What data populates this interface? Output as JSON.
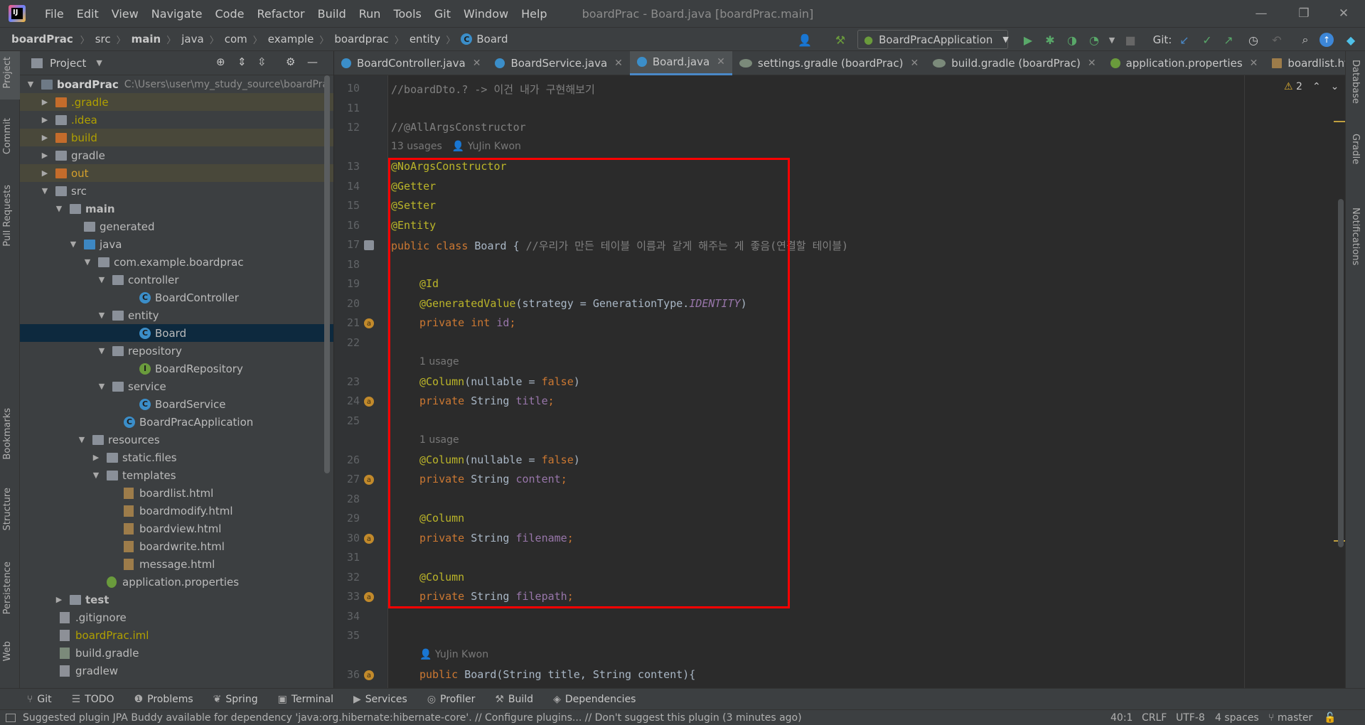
{
  "window": {
    "title": "boardPrac - Board.java [boardPrac.main]",
    "menu": [
      "File",
      "Edit",
      "View",
      "Navigate",
      "Code",
      "Refactor",
      "Build",
      "Run",
      "Tools",
      "Git",
      "Window",
      "Help"
    ]
  },
  "breadcrumb": [
    "boardPrac",
    "src",
    "main",
    "java",
    "com",
    "example",
    "boardprac",
    "entity",
    "Board"
  ],
  "toolbar": {
    "run_config": "BoardPracApplication",
    "git_label": "Git:"
  },
  "project_panel": {
    "title": "Project",
    "root_name": "boardPrac",
    "root_path": "C:\\Users\\user\\my_study_source\\boardPra",
    "items": [
      ".gradle",
      ".idea",
      "build",
      "gradle",
      "out",
      "src",
      "main",
      "generated",
      "java",
      "com.example.boardprac",
      "controller",
      "BoardController",
      "entity",
      "Board",
      "repository",
      "BoardRepository",
      "service",
      "BoardService",
      "BoardPracApplication",
      "resources",
      "static.files",
      "templates",
      "boardlist.html",
      "boardmodify.html",
      "boardview.html",
      "boardwrite.html",
      "message.html",
      "application.properties",
      "test",
      ".gitignore",
      "boardPrac.iml",
      "build.gradle",
      "gradlew"
    ]
  },
  "tabs": [
    "BoardController.java",
    "BoardService.java",
    "Board.java",
    "settings.gradle (boardPrac)",
    "build.gradle (boardPrac)",
    "application.properties",
    "boardlist.html"
  ],
  "active_tab": "Board.java",
  "editor": {
    "warnings": "2",
    "line_numbers": [
      "10",
      "11",
      "12",
      "13",
      "14",
      "15",
      "16",
      "17",
      "18",
      "19",
      "20",
      "21",
      "22",
      "23",
      "24",
      "25",
      "26",
      "27",
      "28",
      "29",
      "30",
      "31",
      "32",
      "33",
      "34",
      "35",
      "36"
    ],
    "hints": {
      "usages13": "13 usages",
      "author": "YuJin Kwon",
      "usage1": "1 usage"
    },
    "code": {
      "l10": "//boardDto.? -> 이건 내가 구현해보기",
      "l12": "//@AllArgsConstructor",
      "l13": "@NoArgsConstructor",
      "l14": "@Getter",
      "l15": "@Setter",
      "l16": "@Entity",
      "l17_kw": "public class ",
      "l17_name": "Board { ",
      "l17_cm": "//우리가 만든 테이블 이름과 같게 해주는 게 좋음(연결할 테이블)",
      "l19": "@Id",
      "l20_an": "@GeneratedValue",
      "l20_rest": "(strategy = GenerationType.",
      "l20_it": "IDENTITY",
      "l20_end": ")",
      "l21_kw": "private int ",
      "l21_f": "id",
      "l23_an": "@Column",
      "l23_rest": "(nullable = ",
      "l23_kw": "false",
      "l23_end": ")",
      "l24_kw": "private ",
      "l24_t": "String ",
      "l24_f": "title",
      "l26_an": "@Column",
      "l26_rest": "(nullable = ",
      "l26_kw": "false",
      "l26_end": ")",
      "l27_kw": "private ",
      "l27_t": "String ",
      "l27_f": "content",
      "l29": "@Column",
      "l30_kw": "private ",
      "l30_t": "String ",
      "l30_f": "filename",
      "l32": "@Column",
      "l33_kw": "private ",
      "l33_t": "String ",
      "l33_f": "filepath",
      "l36_kw": "public ",
      "l36_rest": "Board(String title, String content){",
      "semi": ";"
    }
  },
  "right_stripe": [
    "Database",
    "Gradle",
    "Notifications"
  ],
  "left_stripe": [
    "Project",
    "Commit",
    "Pull Requests",
    "Bookmarks",
    "Structure",
    "Persistence",
    "Web"
  ],
  "bottom_tools": [
    "Git",
    "TODO",
    "Problems",
    "Spring",
    "Terminal",
    "Services",
    "Profiler",
    "Build",
    "Dependencies"
  ],
  "status": {
    "message": "Suggested plugin JPA Buddy available for dependency 'java:org.hibernate:hibernate-core'. // Configure plugins... // Don't suggest this plugin (3 minutes ago)",
    "position": "40:1",
    "line_sep": "CRLF",
    "encoding": "UTF-8",
    "indent": "4 spaces",
    "branch": "master"
  }
}
